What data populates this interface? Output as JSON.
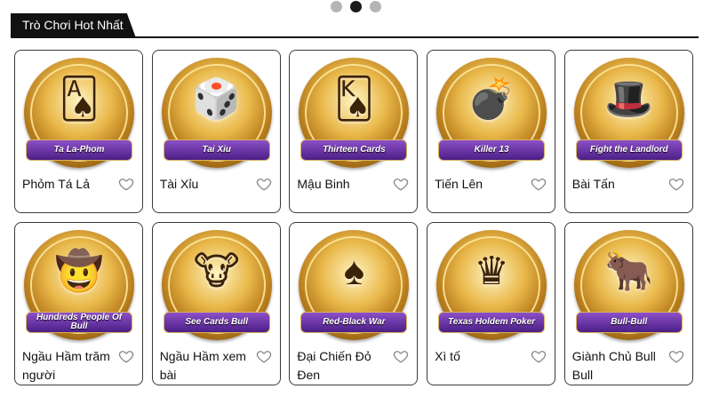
{
  "carousel": {
    "pages": 3,
    "active": 2
  },
  "section": {
    "title": "Trò Chơi Hot Nhất"
  },
  "games": [
    {
      "id": "phom",
      "name": "Phỏm Tá Lả",
      "banner": "Ta La-Phom",
      "glyph": "🂡"
    },
    {
      "id": "tai-xiu",
      "name": "Tài Xỉu",
      "banner": "Tai Xiu",
      "glyph": "🎲"
    },
    {
      "id": "mau-binh",
      "name": "Mậu Binh",
      "banner": "Thirteen Cards",
      "glyph": "🂮"
    },
    {
      "id": "tien-len",
      "name": "Tiến Lên",
      "banner": "Killer 13",
      "glyph": "💣"
    },
    {
      "id": "bai-tan",
      "name": "Bài Tấn",
      "banner": "Fight the Landlord",
      "glyph": "🎩"
    },
    {
      "id": "ngau-ham-tram",
      "name": "Ngầu Hầm trăm người",
      "banner": "Hundreds People Of Bull",
      "glyph": "🤠"
    },
    {
      "id": "ngau-ham-xem",
      "name": "Ngầu Hầm xem bài",
      "banner": "See Cards Bull",
      "glyph": "🐮"
    },
    {
      "id": "dai-chien",
      "name": "Đại Chiến Đỏ Đen",
      "banner": "Red-Black War",
      "glyph": "♠"
    },
    {
      "id": "xi-to",
      "name": "Xì tố",
      "banner": "Texas Holdem Poker",
      "glyph": "♛"
    },
    {
      "id": "bull-bull",
      "name": "Giành Chủ Bull Bull",
      "banner": "Bull-Bull",
      "glyph": "🐂"
    }
  ]
}
